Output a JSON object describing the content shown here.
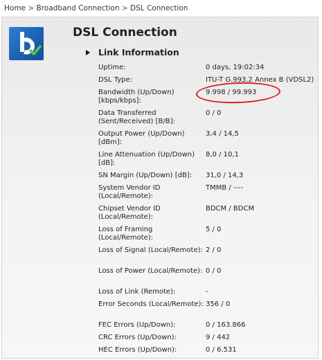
{
  "breadcrumb": {
    "items": [
      "Home",
      "Broadband Connection",
      "DSL Connection"
    ],
    "separator": ">"
  },
  "page": {
    "title": "DSL Connection",
    "logo_icon": "b-checkmark-logo-icon"
  },
  "section": {
    "title": "Link Information"
  },
  "rows": [
    {
      "label": "Uptime:",
      "value": "0 days, 19:02:34"
    },
    {
      "label": "DSL Type:",
      "value": "ITU-T G.993.2 Annex B (VDSL2)"
    },
    {
      "label": "Bandwidth (Up/Down) [kbps/kbps]:",
      "value": "9.998 / 99.993"
    },
    {
      "label": "Data Transferred (Sent/Received) [B/B]:",
      "value": "0 / 0"
    },
    {
      "label": "Output Power (Up/Down) [dBm]:",
      "value": "3,4 / 14,5"
    },
    {
      "label": "Line Attenuation (Up/Down) [dB]:",
      "value": "8,0 / 10,1"
    },
    {
      "label": "SN Margin (Up/Down) [dB]:",
      "value": "31,0 / 14,3"
    },
    {
      "label": "System Vendor ID (Local/Remote):",
      "value": "TMMB / ----"
    },
    {
      "label": "Chipset Vendor ID (Local/Remote):",
      "value": "BDCM / BDCM"
    },
    {
      "label": "Loss of Framing (Local/Remote):",
      "value": "5 / 0"
    },
    {
      "label": "Loss of Signal (Local/Remote):",
      "value": "2 / 0"
    },
    {
      "label": "Loss of Power (Local/Remote):",
      "value": "0 / 0"
    },
    {
      "label": "Loss of Link (Remote):",
      "value": "-"
    },
    {
      "label": "Error Seconds (Local/Remote):",
      "value": "356 / 0"
    },
    {
      "label": "FEC Errors (Up/Down):",
      "value": "0 / 163.866"
    },
    {
      "label": "CRC Errors (Up/Down):",
      "value": "9 / 442"
    },
    {
      "label": "HEC Errors (Up/Down):",
      "value": "0 / 6.531"
    }
  ],
  "annotation": {
    "color": "#d51f1f"
  }
}
